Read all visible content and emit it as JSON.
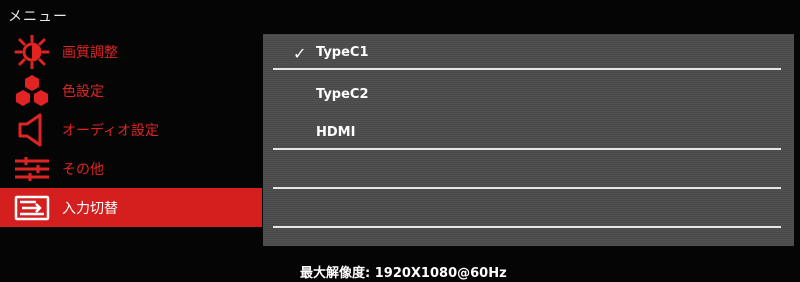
{
  "window": {
    "title": "メニュー"
  },
  "menu": {
    "items": [
      {
        "label": "画質調整",
        "icon": "brightness-icon"
      },
      {
        "label": "色設定",
        "icon": "color-hexagons-icon"
      },
      {
        "label": "オーディオ設定",
        "icon": "speaker-icon"
      },
      {
        "label": "その他",
        "icon": "sliders-icon"
      },
      {
        "label": "入力切替",
        "icon": "input-switch-icon",
        "active": true
      }
    ]
  },
  "panel": {
    "options": [
      {
        "label": "TypeC1",
        "selected": true,
        "check": "✓"
      },
      {
        "label": "TypeC2",
        "selected": false
      },
      {
        "label": "HDMI",
        "selected": false
      },
      {
        "label": "",
        "selected": false
      },
      {
        "label": "",
        "selected": false
      }
    ]
  },
  "status": {
    "text": "最大解像度: 1920X1080@60Hz"
  },
  "colors": {
    "accent": "#d51e1e",
    "label_red": "#e02424",
    "panel": "#4c4c4c"
  }
}
